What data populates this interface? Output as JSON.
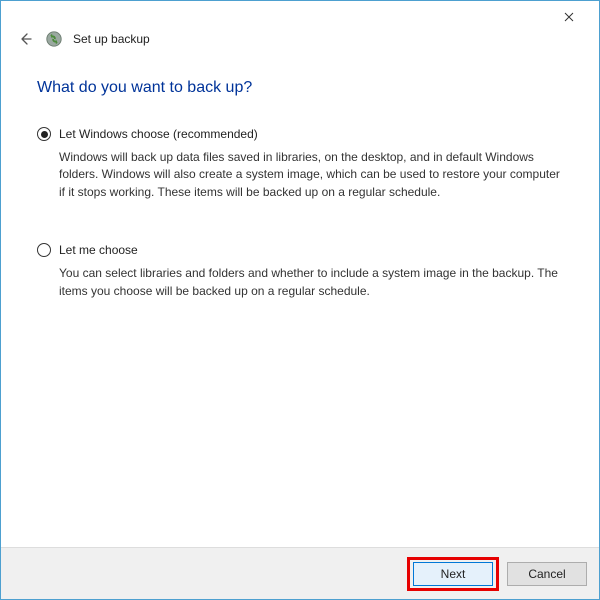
{
  "titlebar": {
    "close_tooltip": "Close"
  },
  "header": {
    "wizard_title": "Set up backup"
  },
  "main": {
    "question": "What do you want to back up?",
    "options": [
      {
        "label": "Let Windows choose (recommended)",
        "description": "Windows will back up data files saved in libraries, on the desktop, and in default Windows folders. Windows will also create a system image, which can be used to restore your computer if it stops working. These items will be backed up on a regular schedule.",
        "selected": true
      },
      {
        "label": "Let me choose",
        "description": "You can select libraries and folders and whether to include a system image in the backup. The items you choose will be backed up on a regular schedule.",
        "selected": false
      }
    ]
  },
  "footer": {
    "next_label": "Next",
    "cancel_label": "Cancel"
  }
}
